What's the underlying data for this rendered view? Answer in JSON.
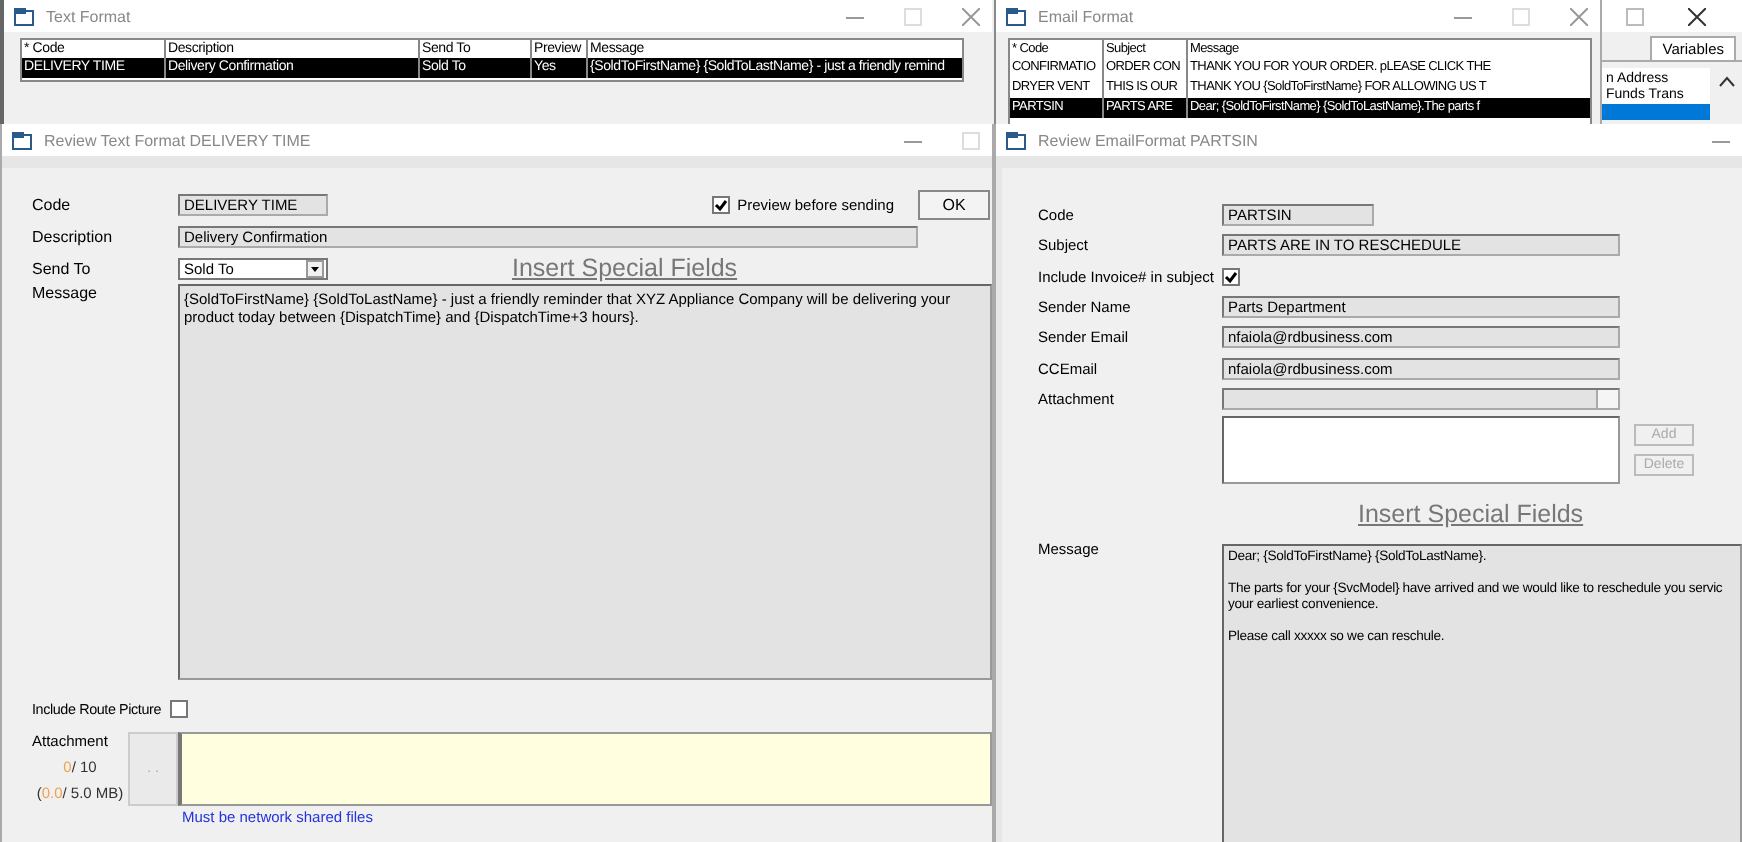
{
  "text_format_window": {
    "title": "Text Format",
    "columns": [
      "* Code",
      "Description",
      "Send To",
      "Preview",
      "Message"
    ],
    "rows": [
      {
        "cells": [
          "DELIVERY TIME",
          "Delivery Confirmation",
          "Sold To",
          "Yes",
          "{SoldToFirstName} {SoldToLastName} - just a friendly remind"
        ],
        "selected": true
      }
    ]
  },
  "email_format_window": {
    "title": "Email Format",
    "columns": [
      "* Code",
      "Subject",
      "Message"
    ],
    "rows": [
      {
        "cells": [
          "CONFIRMATIO",
          "ORDER CON",
          "THANK YOU FOR YOUR ORDER.  pLEASE CLICK THE"
        ],
        "selected": false
      },
      {
        "cells": [
          "DRYER VENT",
          "THIS IS OUR",
          "THANK YOU {SoldToFirstName} FOR ALLOWING US T"
        ],
        "selected": false
      },
      {
        "cells": [
          "PARTSIN",
          "PARTS ARE",
          "Dear; {SoldToFirstName} {SoldToLastName}.The parts f"
        ],
        "selected": true
      }
    ]
  },
  "variables_window": {
    "tab": "Variables",
    "items": [
      {
        "label": "n Address",
        "selected": false
      },
      {
        "label": "Funds Trans",
        "selected": false
      },
      {
        "selected": true
      }
    ]
  },
  "review_text_window": {
    "title": "Review Text Format DELIVERY TIME",
    "code_label": "Code",
    "code": "DELIVERY TIME",
    "description_label": "Description",
    "description": "Delivery Confirmation",
    "send_to_label": "Send To",
    "send_to": "Sold To",
    "preview_label": "Preview before sending",
    "preview_checked": true,
    "ok_button": "OK",
    "insert_link": "Insert Special Fields",
    "message_label": "Message",
    "message": "{SoldToFirstName} {SoldToLastName} - just a friendly reminder that XYZ Appliance Company will be delivering your product today between {DispatchTime} and {DispatchTime+3 hours}.",
    "route_picture_label": "Include Route Picture",
    "route_picture_checked": false,
    "attachment_label": "Attachment",
    "browse_button": ". .",
    "file_count": "0",
    "file_limit": "/ 10",
    "size_open": "(",
    "size_used": "0.0",
    "size_limit": "/ 5.0 MB)",
    "note": "Must be network shared files"
  },
  "review_email_window": {
    "title": "Review EmailFormat PARTSIN",
    "fields": [
      {
        "kind": "short",
        "label": "Code",
        "value": "PARTSIN"
      },
      {
        "kind": "text",
        "label": "Subject",
        "value": "PARTS ARE IN TO RESCHEDULE"
      },
      {
        "kind": "checkbox",
        "label": "Include Invoice# in subject",
        "checked": true
      },
      {
        "kind": "text",
        "label": "Sender Name",
        "value": "Parts Department"
      },
      {
        "kind": "text",
        "label": "Sender Email",
        "value": "nfaiola@rdbusiness.com"
      },
      {
        "kind": "text",
        "label": "CCEmail",
        "value": "nfaiola@rdbusiness.com"
      },
      {
        "kind": "attachment",
        "label": "Attachment"
      }
    ],
    "add_button": {
      "label": "Add",
      "disabled": true
    },
    "delete_button": {
      "label": "Delete",
      "disabled": true
    },
    "insert_link": "Insert Special Fields",
    "message_label": "Message",
    "message_paragraphs": [
      [
        "Dear; {SoldToFirstName} {SoldToLastName}."
      ],
      [
        "The parts for your {SvcModel} have arrived and we would like to reschedule you servic",
        "your earliest convenience."
      ],
      [
        "Please call xxxxx so we can reschule."
      ]
    ]
  }
}
